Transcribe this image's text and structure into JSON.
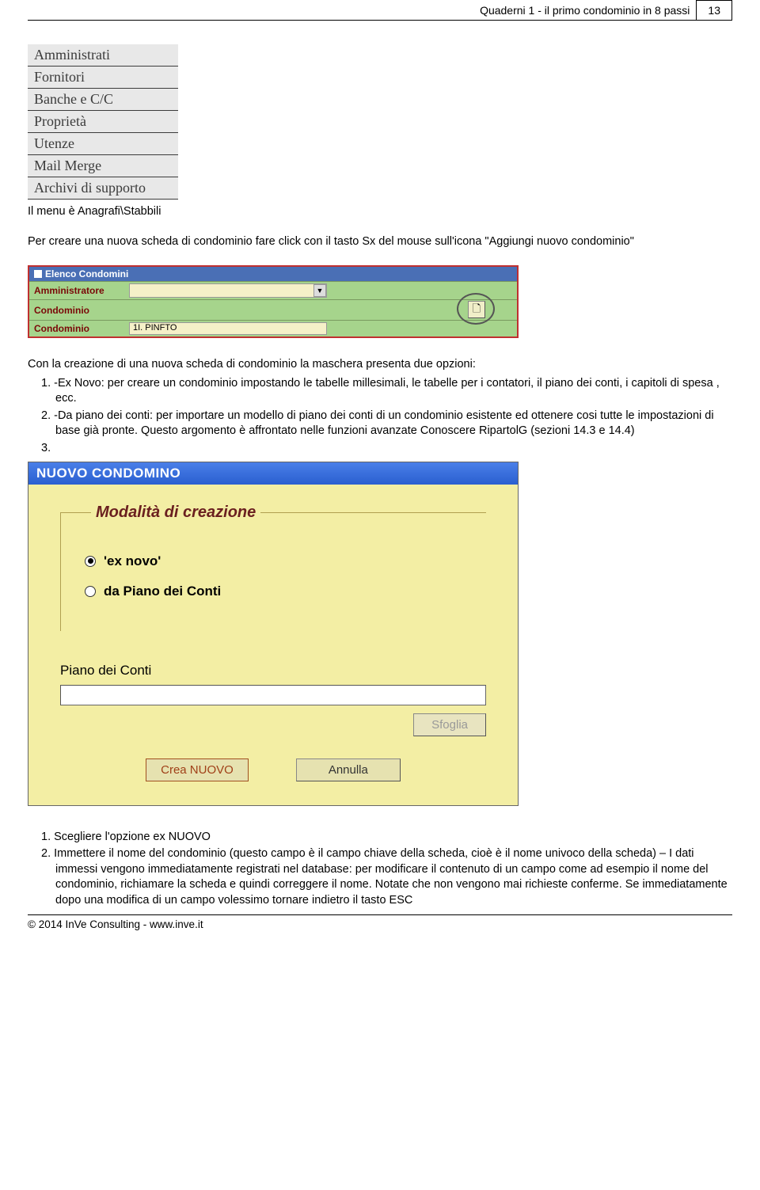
{
  "header": {
    "title": "Quaderni 1 - il primo condominio in 8 passi",
    "page": "13"
  },
  "menu": {
    "items": [
      "Amministrati",
      "Fornitori",
      "Banche e C/C",
      "Proprietà",
      "Utenze",
      "Mail Merge",
      "Archivi di supporto"
    ]
  },
  "text": {
    "menu_caption": "Il menu è Anagrafi\\Stabbili",
    "intro": "Per creare una nuova scheda di condominio fare click con il tasto Sx del mouse sull'icona \"Aggiungi nuovo condominio\"",
    "after_img1": "Con la creazione di una nuova scheda di condominio la maschera presenta due opzioni:",
    "opt1": "1. -Ex Novo: per creare un condominio impostando le tabelle millesimali, le tabelle per i contatori, il piano dei conti, i capitoli di spesa , ecc.",
    "opt2": "2. -Da piano dei conti: per importare un modello di piano dei conti di un condominio esistente ed ottenere cosi tutte le impostazioni di base già pronte. Questo argomento è affrontato nelle funzioni avanzate Conoscere RipartolG (sezioni  14.3 e 14.4)",
    "opt3": "3.",
    "step1": "1.  Scegliere l'opzione  ex NUOVO",
    "step2": "2.  Immettere il nome del condominio (questo campo è il campo chiave della scheda, cioè è il nome univoco della scheda) – I dati immessi vengono immediatamente registrati nel database: per modificare il contenuto di un campo come ad esempio il nome del condominio, richiamare la scheda e quindi correggere il nome. Notate che non vengono mai richieste conferme. Se immediatamente dopo una modifica di un campo volessimo tornare indietro il tasto ESC"
  },
  "img1": {
    "titlebar": "Elenco Condomini",
    "row1_label": "Amministratore",
    "row2_label": "Condominio",
    "row3_label": "Condominio",
    "row3_value": "1I. PINFTO",
    "icon_glyph": "🗋"
  },
  "dialog": {
    "title": "NUOVO CONDOMINO",
    "fieldset_label": "Modalità di creazione",
    "radio1": "'ex novo'",
    "radio2": "da Piano dei Conti",
    "section_label": "Piano dei Conti",
    "btn_browse": "Sfoglia",
    "btn_create": "Crea NUOVO",
    "btn_cancel": "Annulla"
  },
  "footer": {
    "copyright": "© 2014 InVe Consulting - www.inve.it"
  }
}
